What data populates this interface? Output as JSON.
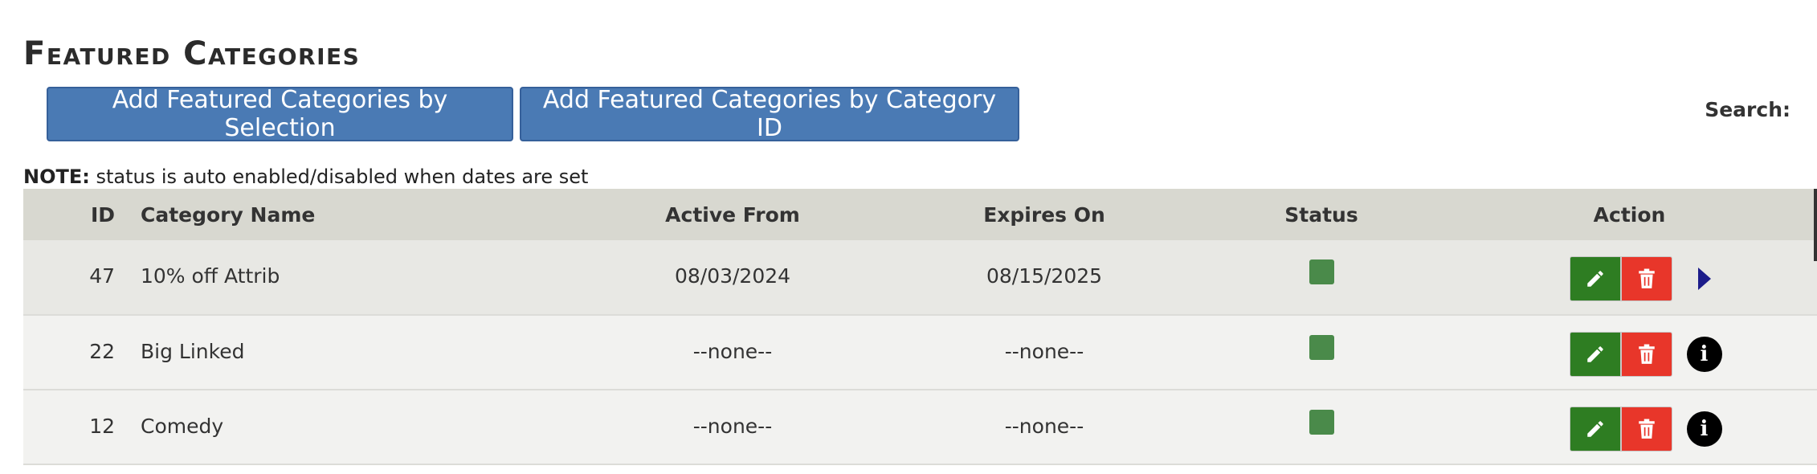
{
  "header": {
    "title": "Featured Categories"
  },
  "toolbar": {
    "add_by_selection": "Add Featured Categories by Selection",
    "add_by_id": "Add Featured Categories by Category ID",
    "search_label": "Search:"
  },
  "note": {
    "prefix": "NOTE:",
    "text": "status is auto enabled/disabled when dates are set"
  },
  "table": {
    "columns": [
      "ID",
      "Category Name",
      "Active From",
      "Expires On",
      "Status",
      "Action"
    ],
    "rows": [
      {
        "id": "47",
        "name": "10% off Attrib",
        "active_from": "08/03/2024",
        "expires_on": "08/15/2025",
        "status": "enabled",
        "extra_icon": "caret-right-icon"
      },
      {
        "id": "22",
        "name": "Big Linked",
        "active_from": "--none--",
        "expires_on": "--none--",
        "status": "enabled",
        "extra_icon": "info-icon"
      },
      {
        "id": "12",
        "name": "Comedy",
        "active_from": "--none--",
        "expires_on": "--none--",
        "status": "enabled",
        "extra_icon": "info-icon"
      }
    ]
  },
  "colors": {
    "primary_button": "#4a7ab4",
    "status_enabled": "#4a8a4a",
    "edit_button": "#2e7d22",
    "delete_button": "#e8362a",
    "header_row": "#d8d8d0"
  }
}
